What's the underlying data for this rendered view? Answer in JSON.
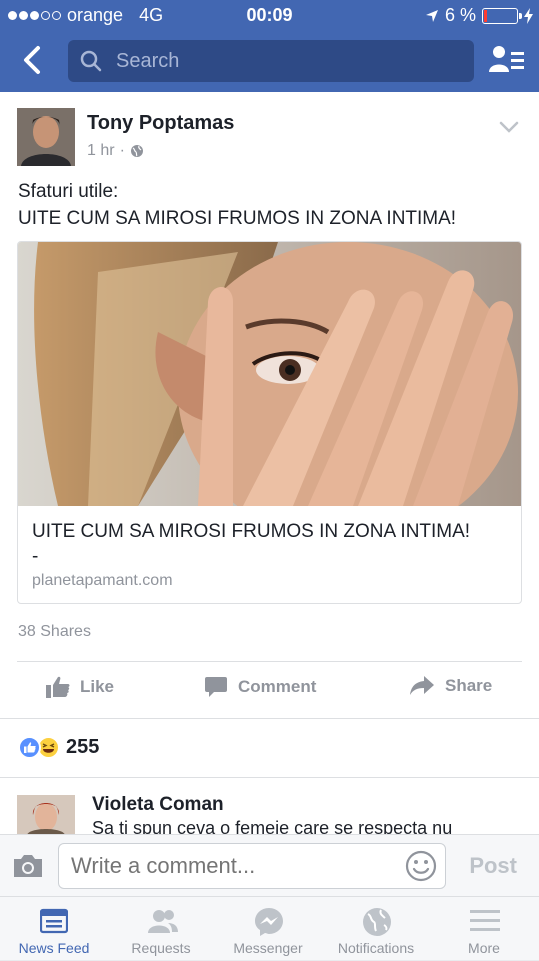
{
  "status_bar": {
    "carrier": "orange",
    "network": "4G",
    "time": "00:09",
    "battery": "6 %"
  },
  "navbar": {
    "search_placeholder": "Search"
  },
  "post": {
    "author": "Tony Poptamas",
    "time": "1 hr",
    "text_line1": "Sfaturi utile:",
    "text_line2": "UITE CUM SA MIROSI FRUMOS IN ZONA INTIMA!",
    "link_title": "UITE CUM SA MIROSI FRUMOS IN ZONA INTIMA!",
    "link_dash": "-",
    "link_domain": "planetapamant.com",
    "shares": "38 Shares",
    "actions": {
      "like": "Like",
      "comment": "Comment",
      "share": "Share"
    },
    "reaction_count": "255"
  },
  "comment": {
    "author": "Violeta Coman",
    "text": "Sa ti spun ceva o femeie care se respecta nu"
  },
  "composer": {
    "placeholder": "Write a comment...",
    "post_label": "Post"
  },
  "tabs": [
    {
      "label": "News Feed",
      "icon": "news-feed-icon",
      "active": true
    },
    {
      "label": "Requests",
      "icon": "requests-icon",
      "active": false
    },
    {
      "label": "Messenger",
      "icon": "messenger-icon",
      "active": false
    },
    {
      "label": "Notifications",
      "icon": "globe-icon",
      "active": false
    },
    {
      "label": "More",
      "icon": "menu-icon",
      "active": false
    }
  ],
  "colors": {
    "brand": "#4267b2",
    "muted": "#90949c",
    "like": "#5890ff",
    "haha": "#fcd03f"
  }
}
